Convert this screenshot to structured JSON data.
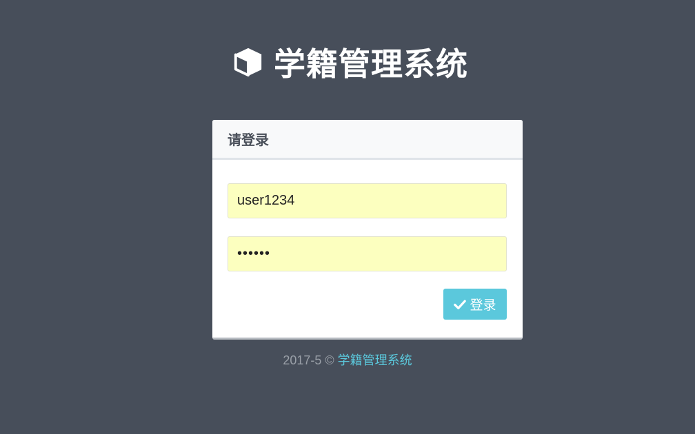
{
  "brand": {
    "icon": "cube-icon",
    "title": "学籍管理系统"
  },
  "login_panel": {
    "heading": "请登录",
    "username_value": "user1234",
    "password_value": "••••••",
    "submit_icon": "check-icon",
    "submit_label": "登录"
  },
  "footer": {
    "prefix": "2017-5 © ",
    "link_text": "学籍管理系统"
  },
  "colors": {
    "background": "#474e5a",
    "accent": "#5bc8dc",
    "input_fill": "#fcffbf"
  }
}
